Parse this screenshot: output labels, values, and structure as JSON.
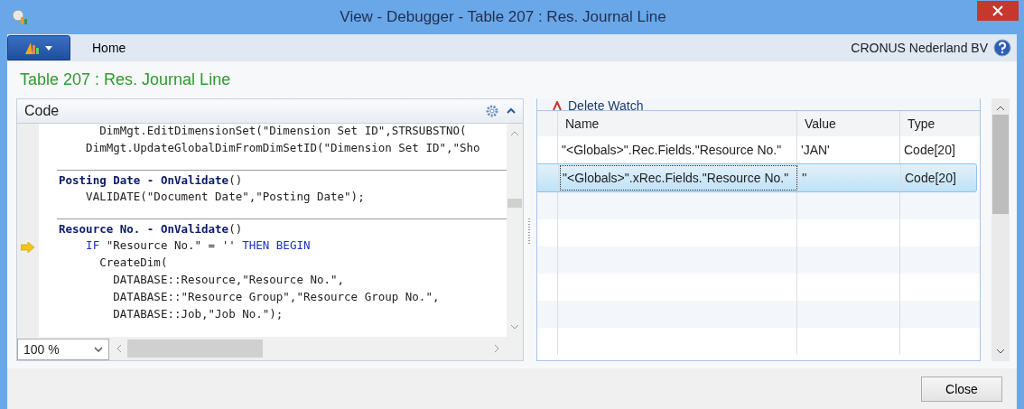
{
  "window": {
    "title": "View - Debugger - Table 207 : Res. Journal Line"
  },
  "ribbon": {
    "tabs": [
      {
        "label": "Home",
        "selected": true
      }
    ],
    "company": "CRONUS Nederland BV"
  },
  "page_title": "Table 207 : Res. Journal Line",
  "code_pane": {
    "title": "Code",
    "zoom": "100 %",
    "lines": [
      {
        "current": false,
        "parts": [
          {
            "kind": "plain",
            "text": "      DimMgt.EditDimensionSet(\"Dimension Set ID\",STRSUBSTNO("
          }
        ]
      },
      {
        "current": false,
        "parts": [
          {
            "kind": "plain",
            "text": "    DimMgt.UpdateGlobalDimFromDimSetID(\"Dimension Set ID\",\"Sho"
          }
        ]
      },
      {
        "current": false,
        "trigger": true,
        "parts": [
          {
            "kind": "trigger",
            "text": "Posting Date - OnValidate"
          },
          {
            "kind": "plain",
            "text": "()"
          }
        ]
      },
      {
        "current": false,
        "parts": [
          {
            "kind": "plain",
            "text": "    VALIDATE(\"Document Date\",\"Posting Date\");"
          }
        ]
      },
      {
        "current": false,
        "trigger": true,
        "parts": [
          {
            "kind": "trigger",
            "text": "Resource No. - OnValidate"
          },
          {
            "kind": "plain",
            "text": "()"
          }
        ]
      },
      {
        "current": true,
        "parts": [
          {
            "kind": "keyword",
            "text": "    IF"
          },
          {
            "kind": "plain",
            "text": " \"Resource No.\" = "
          },
          {
            "kind": "string",
            "text": "''"
          },
          {
            "kind": "keyword",
            "text": " THEN BEGIN"
          }
        ]
      },
      {
        "current": false,
        "parts": [
          {
            "kind": "plain",
            "text": "      CreateDim("
          }
        ]
      },
      {
        "current": false,
        "parts": [
          {
            "kind": "plain",
            "text": "        DATABASE::Resource,\"Resource No.\","
          }
        ]
      },
      {
        "current": false,
        "parts": [
          {
            "kind": "plain",
            "text": "        DATABASE::\"Resource Group\",\"Resource Group No.\","
          }
        ]
      },
      {
        "current": false,
        "parts": [
          {
            "kind": "plain",
            "text": "        DATABASE::Job,\"Job No.\");"
          }
        ]
      }
    ]
  },
  "watch_pane": {
    "action": "Delete Watch",
    "columns": [
      "Name",
      "Value",
      "Type"
    ],
    "rows": [
      {
        "selected": false,
        "cells": [
          "\"<Globals>\".Rec.Fields.\"Resource No.\"",
          "'JAN'",
          "Code[20]"
        ]
      },
      {
        "selected": true,
        "cells": [
          "\"<Globals>\".xRec.Fields.\"Resource No.\"",
          "''",
          "Code[20]"
        ]
      }
    ]
  },
  "buttons": [
    "Close"
  ]
}
